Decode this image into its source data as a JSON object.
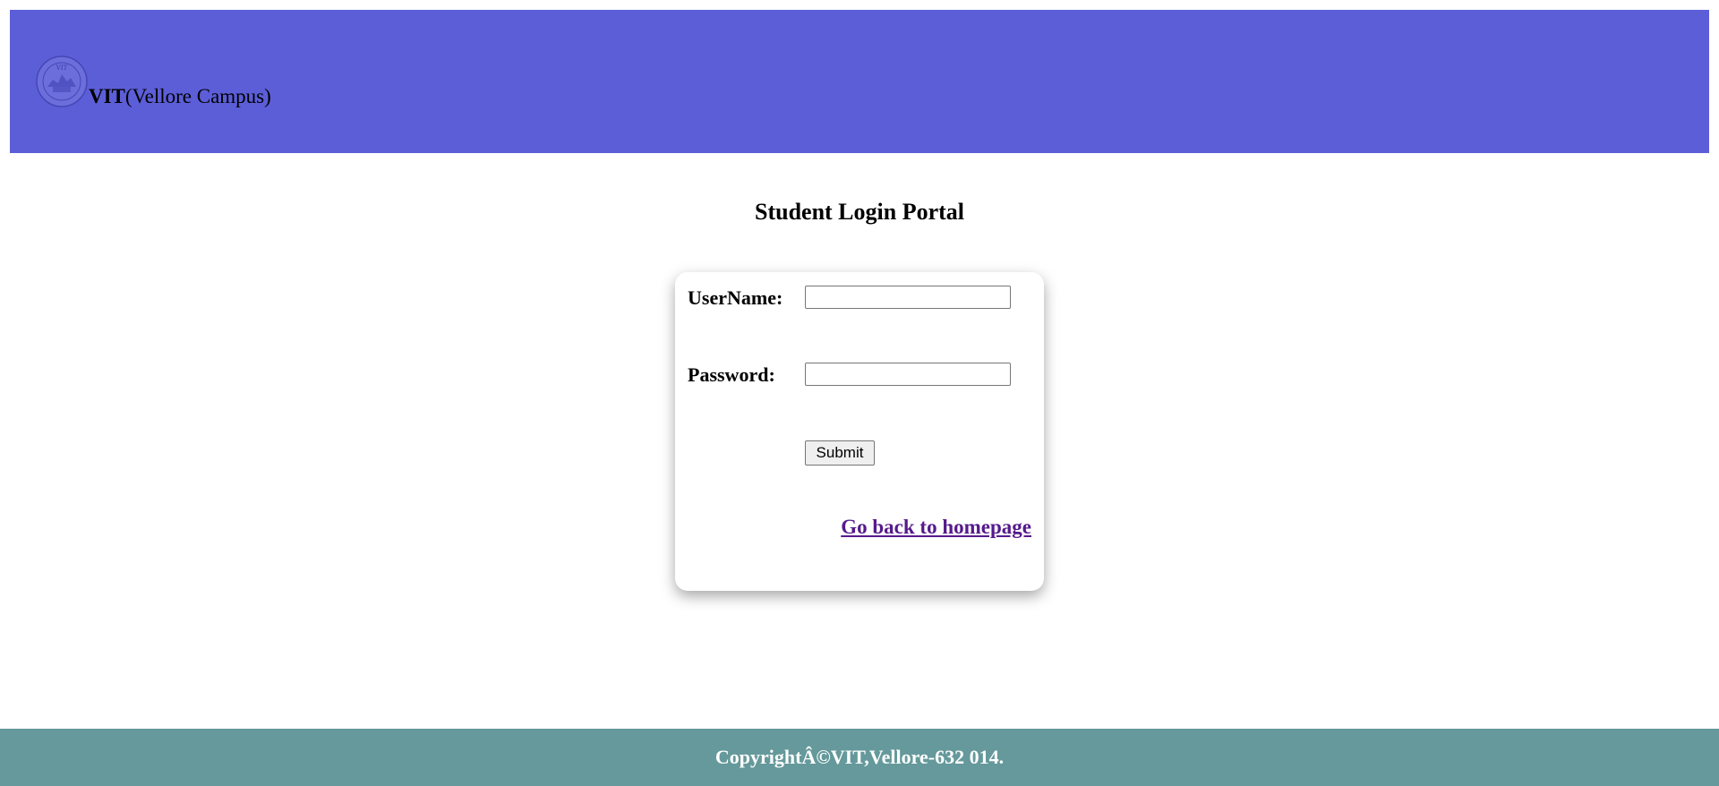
{
  "header": {
    "logo_icon": "vit-seal-icon",
    "brand_bold": "VIT",
    "brand_rest": "(Vellore Campus)",
    "background_color": "#5c5ed8"
  },
  "main": {
    "title": "Student Login Portal"
  },
  "login_form": {
    "username_label": "UserName:",
    "username_value": "",
    "password_label": "Password:",
    "password_value": "",
    "submit_label": "Submit",
    "home_link": "Go back to homepage"
  },
  "footer": {
    "text": "CopyrightÂ©VIT,Vellore-632 014.",
    "background_color": "#65999b"
  }
}
